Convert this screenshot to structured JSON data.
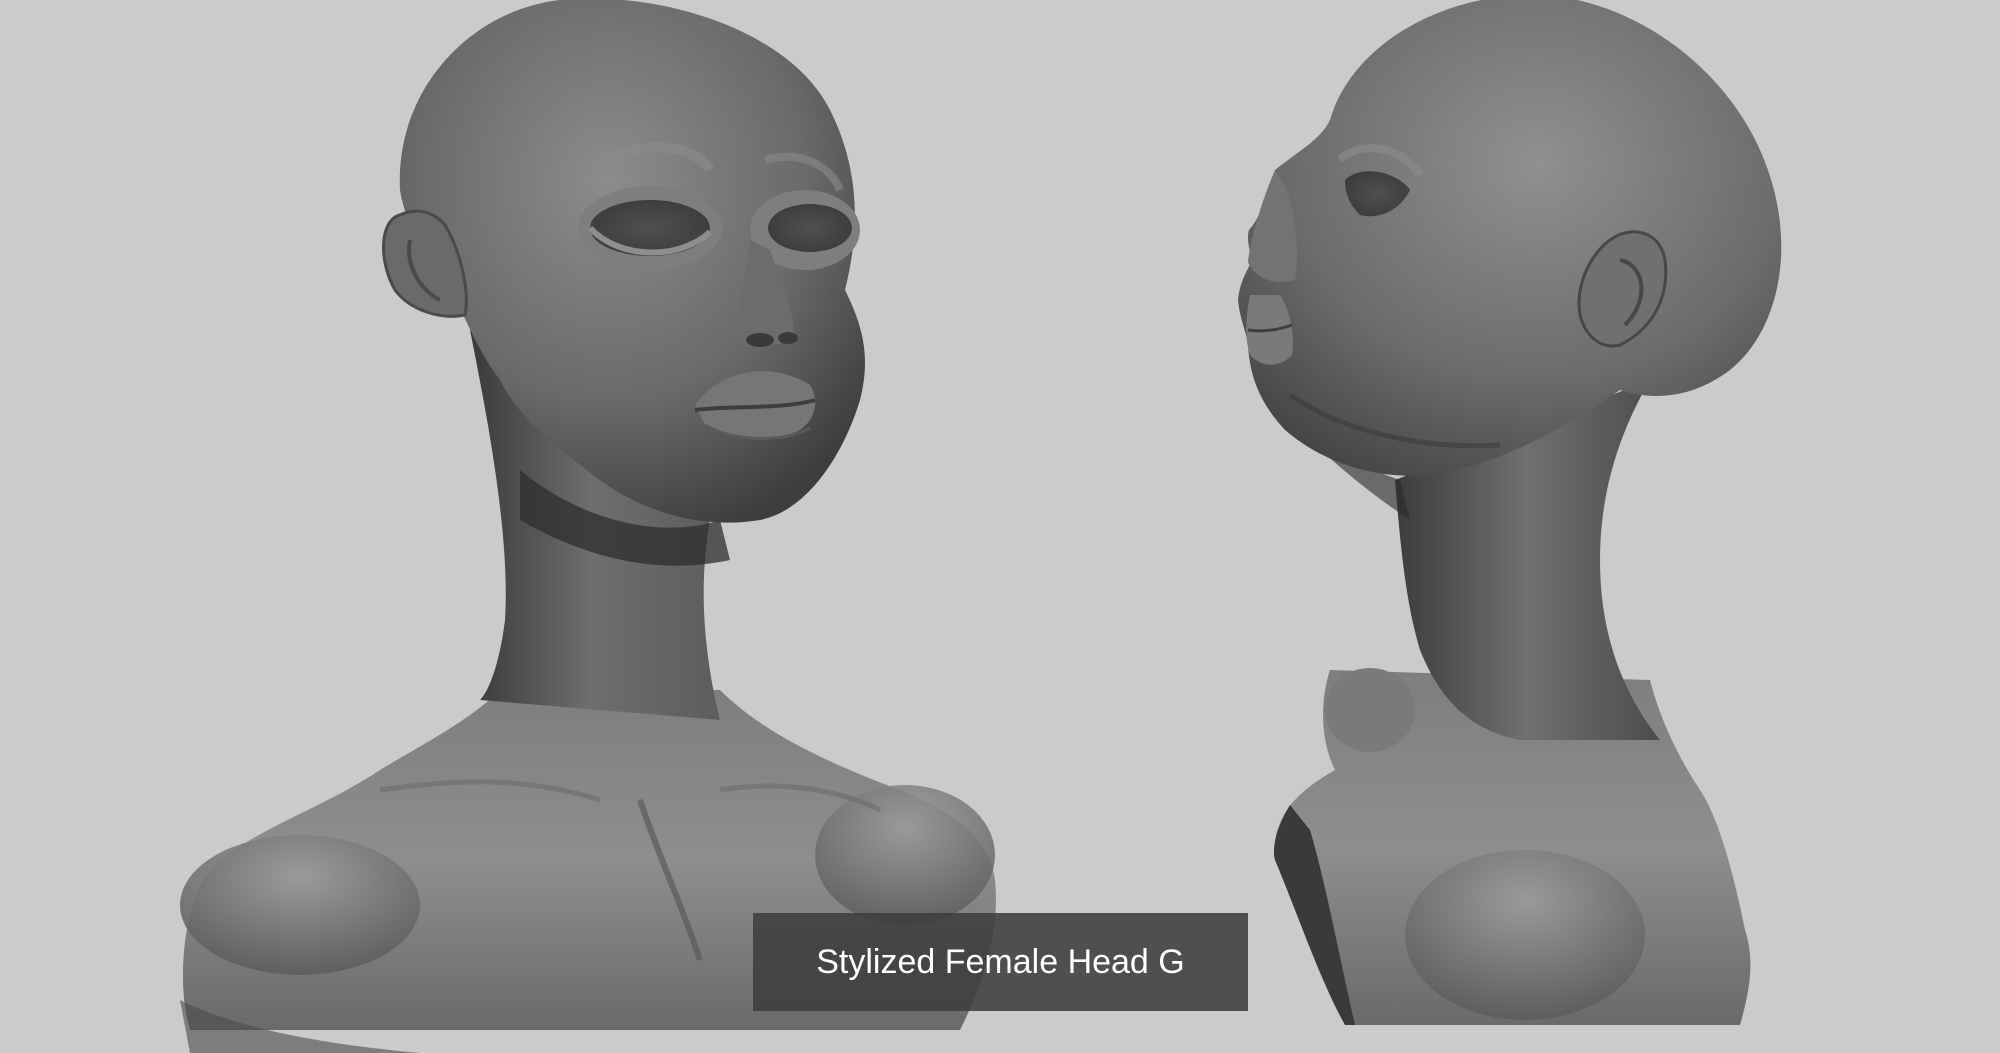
{
  "caption": {
    "title": "Stylized Female Head G"
  },
  "colors": {
    "background": "#cbcbcb",
    "sculpt_mid": "#6f6f6f",
    "sculpt_light": "#9a9a9a",
    "sculpt_dark": "#2e2e2e",
    "caption_bg": "#3e3e3e",
    "caption_text": "#ffffff"
  },
  "views": [
    {
      "view": "three-quarter front"
    },
    {
      "view": "profile"
    }
  ]
}
